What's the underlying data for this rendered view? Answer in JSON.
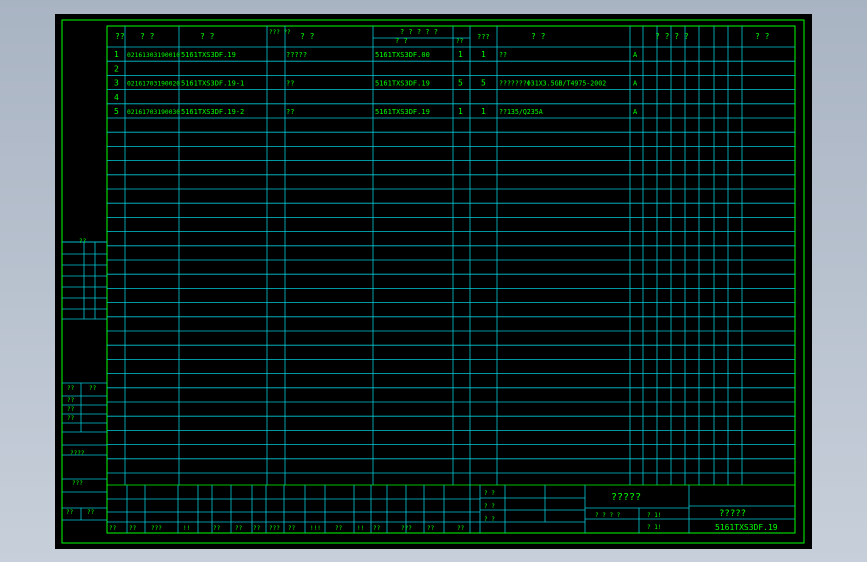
{
  "header": {
    "col1": "??",
    "col2": "?  ?",
    "col3": "?  ?",
    "col4": "???\n??",
    "col5": "?  ?",
    "col6_top": "? ? ? ? ?",
    "col6_left": "?  ?",
    "col6_right": "??",
    "col8": "???",
    "col9": "?  ?",
    "col10": "? ? ? ?",
    "col11": "? ?"
  },
  "rows": [
    {
      "no": "1",
      "code": "02161303190010",
      "drawing": "5161TXS3DF.19",
      "name": "?????",
      "spec": "5161TXS3DF.00",
      "q1": "1",
      "q2": "1",
      "material": "??",
      "mark": "A"
    },
    {
      "no": "2",
      "code": "",
      "drawing": "",
      "name": "",
      "spec": "",
      "q1": "",
      "q2": "",
      "material": "",
      "mark": ""
    },
    {
      "no": "3",
      "code": "02161703190020",
      "drawing": "5161TXS3DF.19-1",
      "name": "??",
      "spec": "5161TXS3DF.19",
      "q1": "5",
      "q2": "5",
      "material": "???????Φ31X3.5GB/T4975-2002",
      "mark": "A"
    },
    {
      "no": "4",
      "code": "",
      "drawing": "",
      "name": "",
      "spec": "",
      "q1": "",
      "q2": "",
      "material": "",
      "mark": ""
    },
    {
      "no": "5",
      "code": "02161703190030",
      "drawing": "5161TXS3DF.19-2",
      "name": "??",
      "spec": "5161TXS3DF.19",
      "q1": "1",
      "q2": "1",
      "material": "??135/Q235A",
      "mark": "A"
    }
  ],
  "side": {
    "top_label": "??",
    "r1a": "??",
    "r1b": "??",
    "r2": "??",
    "r3": "??",
    "r4": "??",
    "r5": "????",
    "r6": "???",
    "r7a": "??",
    "r7b": "??"
  },
  "titleblock": {
    "bottom_labels": [
      "??",
      "??",
      "???",
      "!!",
      "??",
      "??",
      "??",
      "???",
      "??",
      "!!!",
      "??",
      "!!",
      "??",
      "???",
      "??",
      "??"
    ],
    "mid_labels": [
      "? ?",
      "? ?",
      "? ?"
    ],
    "title": "?????",
    "sub1": "? ? ? ?",
    "sub2": "? 1!",
    "sub3": "? 1!",
    "company": "?????",
    "drawing_no": "5161TXS3DF.19"
  },
  "colors": {
    "frame": "#00ff00",
    "grid": "#00c8d8",
    "text": "#00ff00",
    "paper": "#000000"
  }
}
